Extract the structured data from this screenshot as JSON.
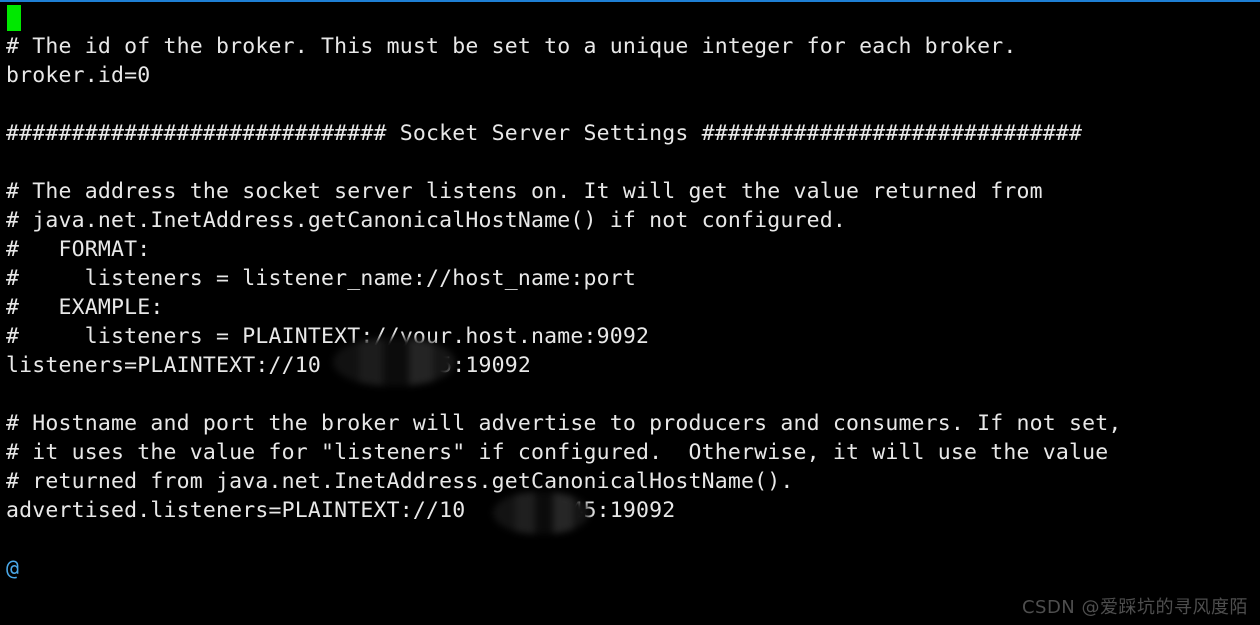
{
  "window": {
    "kind": "terminal",
    "background_color": "#000000",
    "foreground_color": "#e8e8e8",
    "top_rule_color": "#1e7fd4",
    "cursor_color": "#00e800",
    "prompt_color": "#4aa8e8"
  },
  "terminal": {
    "cursor_glyph": "█",
    "prompt_text": "@",
    "lines": [
      {
        "id": "line-01",
        "text": ""
      },
      {
        "id": "line-02",
        "text": "# The id of the broker. This must be set to a unique integer for each broker."
      },
      {
        "id": "line-03",
        "text": "broker.id=0"
      },
      {
        "id": "line-04",
        "text": ""
      },
      {
        "id": "line-05",
        "text": "############################# Socket Server Settings #############################"
      },
      {
        "id": "line-06",
        "text": ""
      },
      {
        "id": "line-07",
        "text": "# The address the socket server listens on. It will get the value returned from"
      },
      {
        "id": "line-08",
        "text": "# java.net.InetAddress.getCanonicalHostName() if not configured."
      },
      {
        "id": "line-09",
        "text": "#   FORMAT:"
      },
      {
        "id": "line-10",
        "text": "#     listeners = listener_name://host_name:port"
      },
      {
        "id": "line-11",
        "text": "#   EXAMPLE:"
      },
      {
        "id": "line-12",
        "text": "#     listeners = PLAINTEXT://your.host.name:9092"
      },
      {
        "id": "line-13",
        "text": "listeners=PLAINTEXT://10       245:19092"
      },
      {
        "id": "line-14",
        "text": ""
      },
      {
        "id": "line-15",
        "text": "# Hostname and port the broker will advertise to producers and consumers. If not set,"
      },
      {
        "id": "line-16",
        "text": "# it uses the value for \"listeners\" if configured.  Otherwise, it will use the value"
      },
      {
        "id": "line-17",
        "text": "# returned from java.net.InetAddress.getCanonicalHostName()."
      },
      {
        "id": "line-18",
        "text": "advertised.listeners=PLAINTEXT://10      .245:19092"
      },
      {
        "id": "line-19",
        "text": ""
      },
      {
        "id": "line-20",
        "text": "@"
      }
    ]
  },
  "redactions": [
    {
      "id": "redaction-1",
      "label": "ip-octets-redacted-listeners"
    },
    {
      "id": "redaction-2",
      "label": "ip-octets-redacted-advertised-listeners"
    }
  ],
  "watermark": {
    "text": "CSDN @爱踩坑的寻风度陌"
  }
}
